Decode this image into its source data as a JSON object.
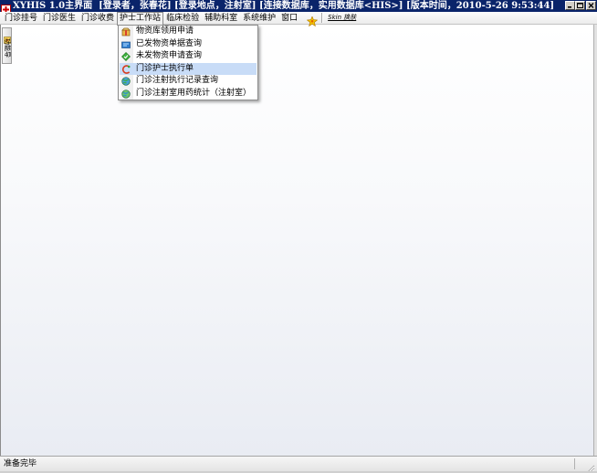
{
  "window": {
    "title": "XYHIS 1.0主界面  [登录者，张春花] [登录地点，注射室] [连接数据库，实用数据库<HIS>] [版本时间，2010-5-26 9:53:44]",
    "app_icon": "app-logo-icon",
    "controls": [
      "minimize-icon",
      "maximize-icon",
      "close-icon"
    ]
  },
  "menubar": {
    "items": [
      {
        "label": "门诊挂号"
      },
      {
        "label": "门诊医生"
      },
      {
        "label": "门诊收费"
      },
      {
        "label": "护士工作站",
        "open": true
      },
      {
        "label": "临床检验"
      },
      {
        "label": "辅助科室"
      },
      {
        "label": "系统维护"
      },
      {
        "label": "窗口"
      }
    ],
    "skin_icon": "skin-icon",
    "skin_label": "Skin 换肤"
  },
  "nurse_menu": {
    "items": [
      {
        "label": "物资库领用申请",
        "icon": "package-icon"
      },
      {
        "label": "已发物资单据查询",
        "icon": "document-card-icon"
      },
      {
        "label": "未发物资申请查询",
        "icon": "green-check-icon"
      },
      {
        "label": "门诊护士执行单",
        "icon": "pen-icon",
        "highlighted": true
      },
      {
        "label": "门诊注射执行记录查询",
        "icon": "globe-icon"
      },
      {
        "label": "门诊注射室用药统计（注射室）",
        "icon": "globe-icon"
      }
    ]
  },
  "side_panel": {
    "label": "功能导航",
    "icon": "navigation-icon"
  },
  "statusbar": {
    "text": "准备完毕"
  },
  "colors": {
    "titlebar": "#0a246a",
    "title_text": "#ffffff",
    "menu_highlight": "#c8dcf7"
  }
}
